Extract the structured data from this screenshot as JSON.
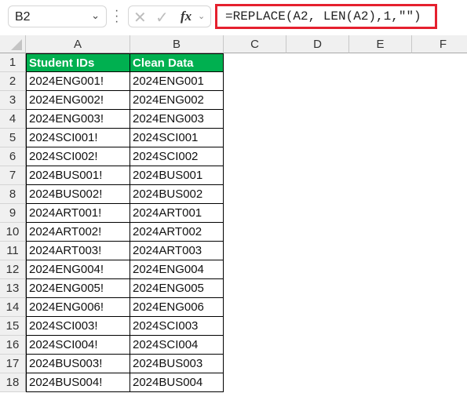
{
  "formula_bar": {
    "name_box": "B2",
    "name_box_chevron": "⌄",
    "cancel_icon": "✕",
    "enter_icon": "✓",
    "fx_label": "fx",
    "fx_chevron": "⌄",
    "formula": "=REPLACE(A2, LEN(A2),1,\"\")",
    "highlight_color": "#e5202e"
  },
  "columns": [
    "A",
    "B",
    "C",
    "D",
    "E",
    "F"
  ],
  "header_fill_color": "#00b050",
  "table": {
    "headers": [
      "Student IDs",
      "Clean Data"
    ],
    "rows": [
      [
        "2024ENG001!",
        "2024ENG001"
      ],
      [
        "2024ENG002!",
        "2024ENG002"
      ],
      [
        "2024ENG003!",
        "2024ENG003"
      ],
      [
        "2024SCI001!",
        "2024SCI001"
      ],
      [
        "2024SCI002!",
        "2024SCI002"
      ],
      [
        "2024BUS001!",
        "2024BUS001"
      ],
      [
        "2024BUS002!",
        "2024BUS002"
      ],
      [
        "2024ART001!",
        "2024ART001"
      ],
      [
        "2024ART002!",
        "2024ART002"
      ],
      [
        "2024ART003!",
        "2024ART003"
      ],
      [
        "2024ENG004!",
        "2024ENG004"
      ],
      [
        "2024ENG005!",
        "2024ENG005"
      ],
      [
        "2024ENG006!",
        "2024ENG006"
      ],
      [
        "2024SCI003!",
        "2024SCI003"
      ],
      [
        "2024SCI004!",
        "2024SCI004"
      ],
      [
        "2024BUS003!",
        "2024BUS003"
      ],
      [
        "2024BUS004!",
        "2024BUS004"
      ]
    ]
  },
  "row_numbers": [
    "1",
    "2",
    "3",
    "4",
    "5",
    "6",
    "7",
    "8",
    "9",
    "10",
    "11",
    "12",
    "13",
    "14",
    "15",
    "16",
    "17",
    "18"
  ]
}
